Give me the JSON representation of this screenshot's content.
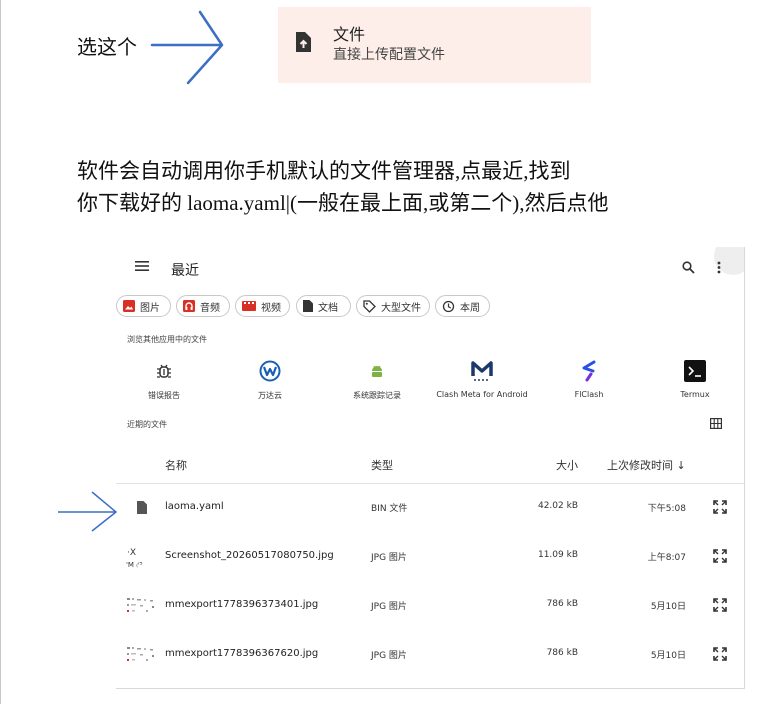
{
  "instruction": {
    "pick_label": "选这个",
    "line1": "软件会自动调用你手机默认的文件管理器,点最近,找到",
    "line2": "你下载好的 laoma.yaml|(一般在最上面,或第二个),然后点他"
  },
  "file_option": {
    "title": "文件",
    "subtitle": "直接上传配置文件",
    "icon": "file-upload-icon"
  },
  "picker": {
    "title": "最近",
    "chips": [
      {
        "label": "图片",
        "icon": "image-icon",
        "color": "#d93025"
      },
      {
        "label": "音频",
        "icon": "audio-icon",
        "color": "#d93025"
      },
      {
        "label": "视频",
        "icon": "video-icon",
        "color": "#d93025"
      },
      {
        "label": "文档",
        "icon": "document-icon",
        "color": "#333333"
      },
      {
        "label": "大型文件",
        "icon": "tag-icon",
        "color": "#333333"
      },
      {
        "label": "本周",
        "icon": "history-icon",
        "color": "#333333"
      }
    ],
    "other_apps_label": "浏览其他应用中的文件",
    "apps": [
      {
        "name": "错误报告",
        "icon": "bug-icon"
      },
      {
        "name": "万达云",
        "icon": "wanda-cloud-icon"
      },
      {
        "name": "系统跟踪记录",
        "icon": "android-icon"
      },
      {
        "name": "Clash Meta for Android",
        "icon": "clash-meta-icon"
      },
      {
        "name": "FlClash",
        "icon": "flclash-icon"
      },
      {
        "name": "Termux",
        "icon": "terminal-icon"
      }
    ],
    "recent_label": "近期的文件",
    "columns": {
      "name": "名称",
      "type": "类型",
      "size": "大小",
      "modified": "上次修改时间 ↓"
    },
    "files": [
      {
        "name": "laoma.yaml",
        "type": "BIN 文件",
        "size": "42.02 kB",
        "modified": "下午5:08"
      },
      {
        "name": "Screenshot_20260517080750.jpg",
        "type": "JPG 图片",
        "size": "11.09 kB",
        "modified": "上午8:07"
      },
      {
        "name": "mmexport1778396373401.jpg",
        "type": "JPG 图片",
        "size": "786 kB",
        "modified": "5月10日"
      },
      {
        "name": "mmexport1778396367620.jpg",
        "type": "JPG 图片",
        "size": "786 kB",
        "modified": "5月10日"
      }
    ]
  },
  "colors": {
    "card_bg": "#fdeee9",
    "accent_red": "#d93025",
    "arrow_blue": "#3c6fc4"
  }
}
